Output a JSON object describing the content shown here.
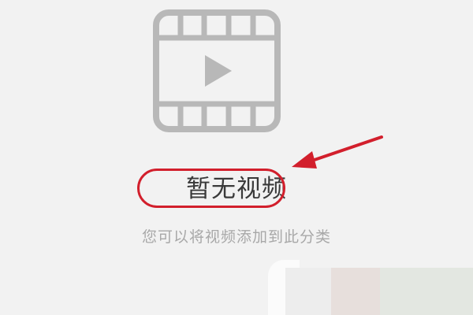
{
  "empty_state": {
    "icon": "video-film-icon",
    "title": "暂无视频",
    "subtitle": "您可以将视频添加到此分类"
  },
  "annotation": {
    "color": "#d21f2c"
  },
  "colors": {
    "icon": "#b8b8b8",
    "background": "#f2f2f2"
  }
}
